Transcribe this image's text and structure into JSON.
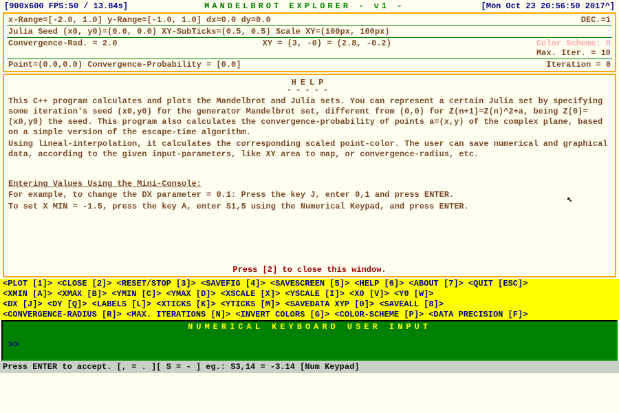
{
  "top": {
    "left": "[900x600 FPS:50 / 13.84s]",
    "center": "MANDELBROT  EXPLORER  - v1 -",
    "right": "[Mon Oct 23 20:56:50 2017^]"
  },
  "info": {
    "row1_l": "x-Range=[-2.0, 1.0] y-Range=[-1.0, 1.0] dx=0.0 dy=0.0",
    "row1_r": "DEC.=1",
    "row2_l": "Julia Seed (x0, y0)=(0.0, 0.0) XY-SubTicks=(0.5, 0.5) Scale XY=(100px, 100px)",
    "row3_l": "Convergence-Rad. = 2.0",
    "row3_c": "XY = (3, -0) = (2.8, -0.2)",
    "row3_r1": "Color Scheme: 0",
    "row3_r2": "Max. Iter. = 10",
    "row4_l": "Point=(0.0,0.0)  Convergence-Probability = [0.0]",
    "row4_r": "Iteration = 0"
  },
  "help": {
    "title": "HELP",
    "under": "-----",
    "p1": "This C++ program calculates and plots the Mandelbrot and Julia sets. You can represent a certain Julia set by specifying some iteration's seed (x0,y0) for the generator Mandelbrot set, different from (0,0) for Z(n+1)=Z(n)^2+a, being Z(0)=(x0,y0) the seed. This program also calculates the convergence-probability of points a=(x,y) of the complex plane, based on a simple version of the escape-time algorithm.",
    "p2": "Using lineal-interpolation, it calculates the corresponding scaled point-color. The user can save numerical and graphical data, according to the given input-parameters, like XY area to map, or convergence-radius, etc.",
    "sub": "Entering Values Using the Mini-Console:",
    "p3": "For example, to change the DX parameter = 0.1: Press the key J, enter 0,1 and press ENTER.",
    "p4": "To set X MIN = -1.5, press the key A, enter S1,5 using the Numerical Keypad, and press ENTER.",
    "close": "Press [2] to close this window."
  },
  "cmd": {
    "row1": [
      "<PLOT [1]>",
      "<CLOSE [2]>",
      "<RESET/STOP [3]>",
      "<SAVEFIG [4]>",
      "<SAVESCREEN [5]>",
      "<HELP [6]>",
      "<ABOUT [7]>",
      "<QUIT [ESC]>"
    ],
    "row2": [
      "<XMIN [A]>",
      "<XMAX [B]>",
      "<YMIN [C]>",
      "<YMAX [D]>",
      "<XSCALE [X]>",
      "<YSCALE [I]>",
      "<X0 [V]>",
      "<Y0 [W]>"
    ],
    "row3": [
      "<DX [J]>",
      "<DY [Q]>",
      "<LABELS [L]>",
      "<XTICKS [K]>",
      "<YTICKS [M]>",
      "<SAVEDATA XYP [0]>",
      "<SAVEALL [8]>"
    ],
    "row4": [
      "<CONVERGENCE-RADIUS [R]>",
      "<MAX. ITERATIONS [N]>",
      "<INVERT COLORS [G]>",
      "<COLOR-SCHEME [P]>",
      "<DATA PRECISION [F]>"
    ]
  },
  "numpad": {
    "title": "NUMERICAL KEYBOARD USER INPUT",
    "prompt": ">>"
  },
  "footer": "Press ENTER to accept.      [, = . ][ S = - ] eg.: S3,14 = -3.14 [Num Keypad]"
}
